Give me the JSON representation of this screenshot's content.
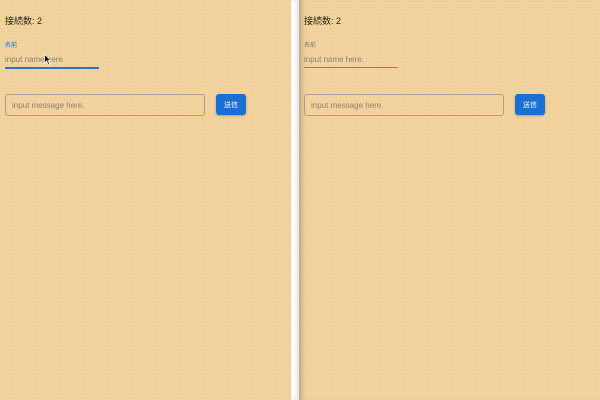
{
  "colors": {
    "background": "#f2d39d",
    "accent": "#1a6fd6",
    "focus": "#2a6fc9"
  },
  "windows": [
    {
      "connections_text": "接続数: 2",
      "name_label": "名前",
      "name_placeholder": "input name here.",
      "name_field_state": "focused",
      "message_placeholder": "input message here.",
      "send_label": "送信"
    },
    {
      "connections_text": "接続数: 2",
      "name_label": "名前",
      "name_placeholder": "input name here.",
      "name_field_state": "unfocused",
      "message_placeholder": "input message here.",
      "send_label": "送信"
    }
  ],
  "pointer_icon": "arrow-cursor-icon"
}
